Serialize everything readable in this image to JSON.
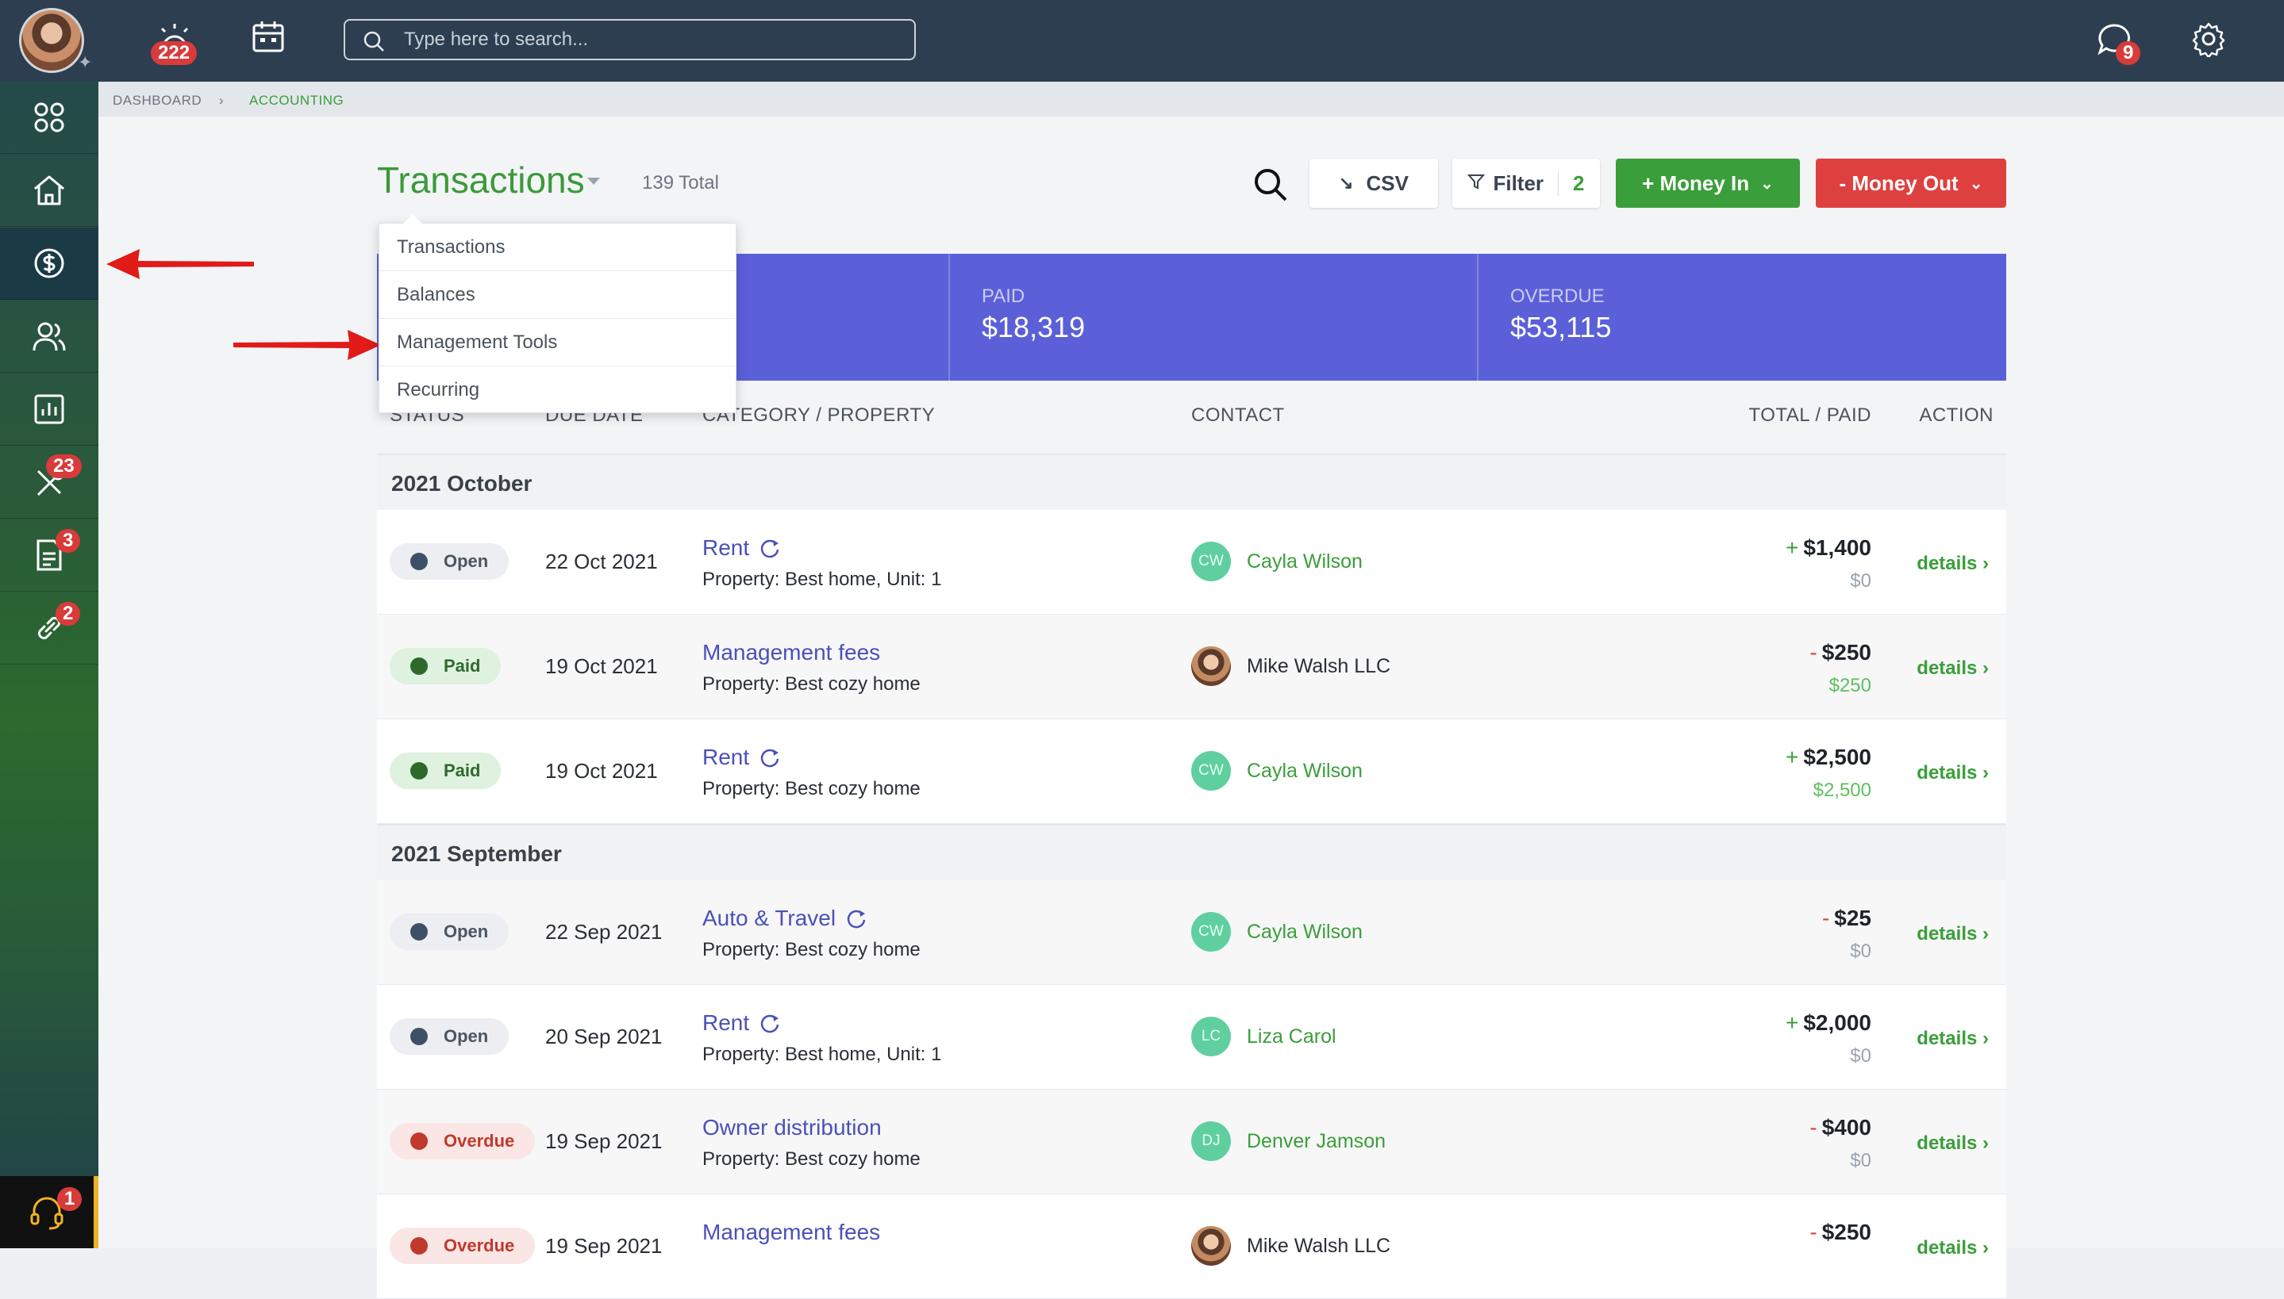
{
  "topbar": {
    "notifications_count": "222",
    "search_placeholder": "Type here to search...",
    "messages_count": "9"
  },
  "sidebar": {
    "tools_count": "23",
    "documents_count": "3",
    "links_count": "2",
    "help_count": "1"
  },
  "breadcrumb": {
    "dashboard": "DASHBOARD",
    "current": "ACCOUNTING"
  },
  "header": {
    "title": "Transactions",
    "total": "139 Total",
    "csv_label": "CSV",
    "filter_label": "Filter",
    "filter_count": "2",
    "money_in_label": "+ Money In",
    "money_out_label": "- Money Out"
  },
  "dropdown": {
    "items": [
      "Transactions",
      "Balances",
      "Management Tools",
      "Recurring"
    ]
  },
  "summary": {
    "paid_label": "PAID",
    "paid_value": "$18,319",
    "overdue_label": "OVERDUE",
    "overdue_value": "$53,115"
  },
  "table": {
    "columns": [
      "STATUS",
      "DUE DATE",
      "CATEGORY / PROPERTY",
      "CONTACT",
      "TOTAL / PAID",
      "ACTION"
    ],
    "groups": [
      "2021 October",
      "2021 September"
    ],
    "details_label": "details",
    "rows": [
      {
        "status": "Open",
        "date": "22 Oct 2021",
        "category": "Rent",
        "property": "Property: Best home, Unit: 1",
        "contact": "Cayla Wilson",
        "initials": "CW",
        "sign": "+",
        "total": "$1,400",
        "paid": "$0"
      },
      {
        "status": "Paid",
        "date": "19 Oct 2021",
        "category": "Management fees",
        "property": "Property: Best cozy home",
        "contact": "Mike Walsh LLC",
        "initials": "",
        "sign": "-",
        "total": "$250",
        "paid": "$250"
      },
      {
        "status": "Paid",
        "date": "19 Oct 2021",
        "category": "Rent",
        "property": "Property: Best cozy home",
        "contact": "Cayla Wilson",
        "initials": "CW",
        "sign": "+",
        "total": "$2,500",
        "paid": "$2,500"
      },
      {
        "status": "Open",
        "date": "22 Sep 2021",
        "category": "Auto & Travel",
        "property": "Property: Best cozy home",
        "contact": "Cayla Wilson",
        "initials": "CW",
        "sign": "-",
        "total": "$25",
        "paid": "$0"
      },
      {
        "status": "Open",
        "date": "20 Sep 2021",
        "category": "Rent",
        "property": "Property: Best home, Unit: 1",
        "contact": "Liza Carol",
        "initials": "LC",
        "sign": "+",
        "total": "$2,000",
        "paid": "$0"
      },
      {
        "status": "Overdue",
        "date": "19 Sep 2021",
        "category": "Owner distribution",
        "property": "Property: Best cozy home",
        "contact": "Denver Jamson",
        "initials": "DJ",
        "sign": "-",
        "total": "$400",
        "paid": "$0"
      },
      {
        "status": "Overdue",
        "date": "19 Sep 2021",
        "category": "Management fees",
        "property": "",
        "contact": "Mike Walsh LLC",
        "initials": "",
        "sign": "-",
        "total": "$250",
        "paid": ""
      }
    ]
  },
  "colors": {
    "accent_green": "#3a9e3a",
    "danger_red": "#de4040",
    "summary_blue": "#5b60d8",
    "link_blue": "#4a50b8"
  }
}
